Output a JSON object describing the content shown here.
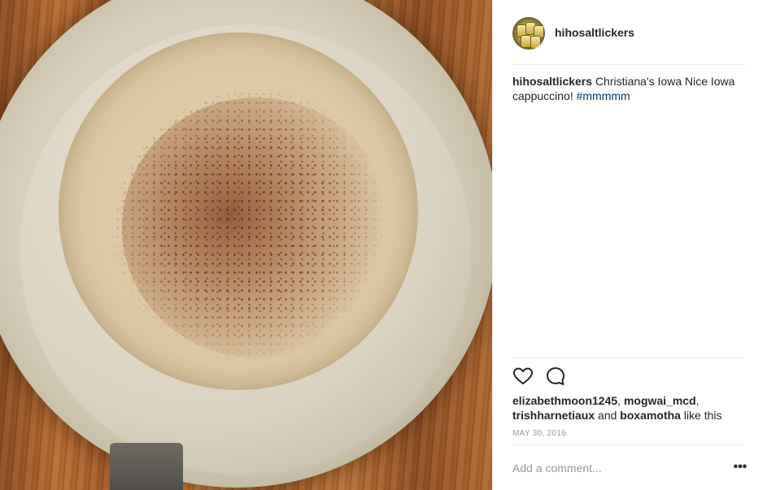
{
  "post": {
    "username": "hihosaltlickers",
    "caption": {
      "username": "hihosaltlickers",
      "text": "Christiana's Iowa Nice Iowa cappuccino!",
      "hashtag": "#mmmmm"
    },
    "likes": {
      "user1": "elizabethmoon1245",
      "sep1": ", ",
      "user2": "mogwai_mcd",
      "sep2": ",",
      "user3": "trishharnetiaux",
      "and": " and ",
      "user4": "boxamotha",
      "suffix": " like this"
    },
    "date": "MAY 30, 2016",
    "comment_placeholder": "Add a comment...",
    "more_label": "•••"
  },
  "icons": {
    "like": "heart-icon",
    "comment": "speech-bubble-icon",
    "more": "more-options-icon"
  },
  "colors": {
    "text": "#262626",
    "hashtag": "#003569",
    "muted": "#999999",
    "divider": "#efefef"
  }
}
